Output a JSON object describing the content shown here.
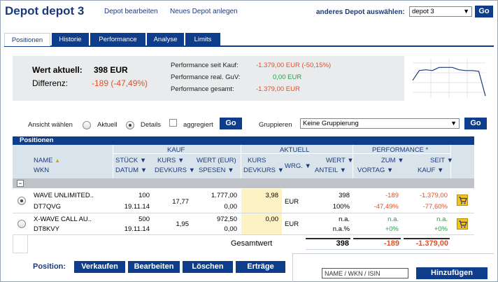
{
  "header": {
    "title": "Depot depot 3",
    "edit_link": "Depot bearbeiten",
    "new_link": "Neues Depot anlegen",
    "other_label": "anderes Depot auswählen:",
    "depot_select": "depot 3",
    "go_label": "Go"
  },
  "tabs": [
    {
      "label": "Positionen",
      "active": true
    },
    {
      "label": "Historie",
      "active": false
    },
    {
      "label": "Performance",
      "active": false
    },
    {
      "label": "Analyse",
      "active": false
    },
    {
      "label": "Limits",
      "active": false
    }
  ],
  "summary": {
    "wert_label": "Wert aktuell:",
    "wert_value": "398 EUR",
    "diff_label": "Differenz:",
    "diff_value": "-189 (-47,49%)",
    "perf_kauf_label": "Performance seit Kauf:",
    "perf_kauf_value": "-1.379,00 EUR (-50,15%)",
    "perf_guv_label": "Performance real. GuV:",
    "perf_guv_value": "0,00 EUR",
    "perf_ges_label": "Performance gesamt:",
    "perf_ges_value": "-1.379,00 EUR"
  },
  "view": {
    "ansicht_label": "Ansicht wählen",
    "aktuell_label": "Aktuell",
    "details_label": "Details",
    "aggregiert_label": "aggregiert",
    "go_label": "Go",
    "gruppieren_label": "Gruppieren",
    "gruppieren_select": "Keine Gruppierung",
    "go2_label": "Go"
  },
  "table": {
    "title": "Positionen",
    "groups": {
      "kauf": "KAUF",
      "aktuell": "AKTUELL",
      "performance": "PERFORMANCE *"
    },
    "cols": {
      "name": "NAME",
      "wkn": "WKN",
      "stueck": "STÜCK",
      "datum": "DATUM",
      "kurs": "KURS",
      "devkurs": "DEVKURS",
      "wert_eur": "WERT (EUR)",
      "spesen": "SPESEN",
      "akurs": "KURS",
      "adevkurs": "DEVKURS",
      "wrg": "WRG.",
      "wert": "WERT",
      "anteil": "ANTEIL",
      "zum": "ZUM",
      "vortag": "VORTAG",
      "seit": "SEIT",
      "kauf": "KAUF"
    },
    "rows": [
      {
        "name": "WAVE UNLIMITED..",
        "wkn": "DT7QVG",
        "stueck": "100",
        "datum": "19.11.14",
        "kurs": "17,77",
        "wert": "1.777,00",
        "spesen": "0,00",
        "akurs": "3,98",
        "wrg": "EUR",
        "awert": "398",
        "anteil": "100%",
        "vortag_abs": "-189",
        "vortag_pct": "-47,49%",
        "kauf_abs": "-1.379,00",
        "kauf_pct": "-77,60%"
      },
      {
        "name": "X-WAVE CALL AU..",
        "wkn": "DT8KVY",
        "stueck": "500",
        "datum": "19.11.14",
        "kurs": "1,95",
        "wert": "972,50",
        "spesen": "0,00",
        "akurs": "0,00",
        "wrg": "EUR",
        "awert": "n.a.",
        "anteil": "n.a.%",
        "vortag_abs": "n.a.",
        "vortag_pct": "+0%",
        "kauf_abs": "n.a.",
        "kauf_pct": "+0%"
      }
    ],
    "gesamt_label": "Gesamtwert",
    "gesamt_wert": "398",
    "gesamt_vortag": "-189",
    "gesamt_kauf": "-1.379,00"
  },
  "actions": {
    "position_label": "Position:",
    "verkaufen": "Verkaufen",
    "bearbeiten": "Bearbeiten",
    "loeschen": "Löschen",
    "ertraege": "Erträge",
    "search_placeholder": "NAME / WKN / ISIN",
    "hinzufuegen": "Hinzufügen"
  },
  "colors": {
    "brand": "#0e3d8c",
    "negative": "#e0502a",
    "positive": "#2a9a4a",
    "highlight": "#fdf2c4"
  },
  "sparkline": [
    0.55,
    0.3,
    0.28,
    0.3,
    0.22,
    0.22,
    0.22,
    0.28,
    0.3,
    0.3,
    0.32,
    0.95
  ]
}
